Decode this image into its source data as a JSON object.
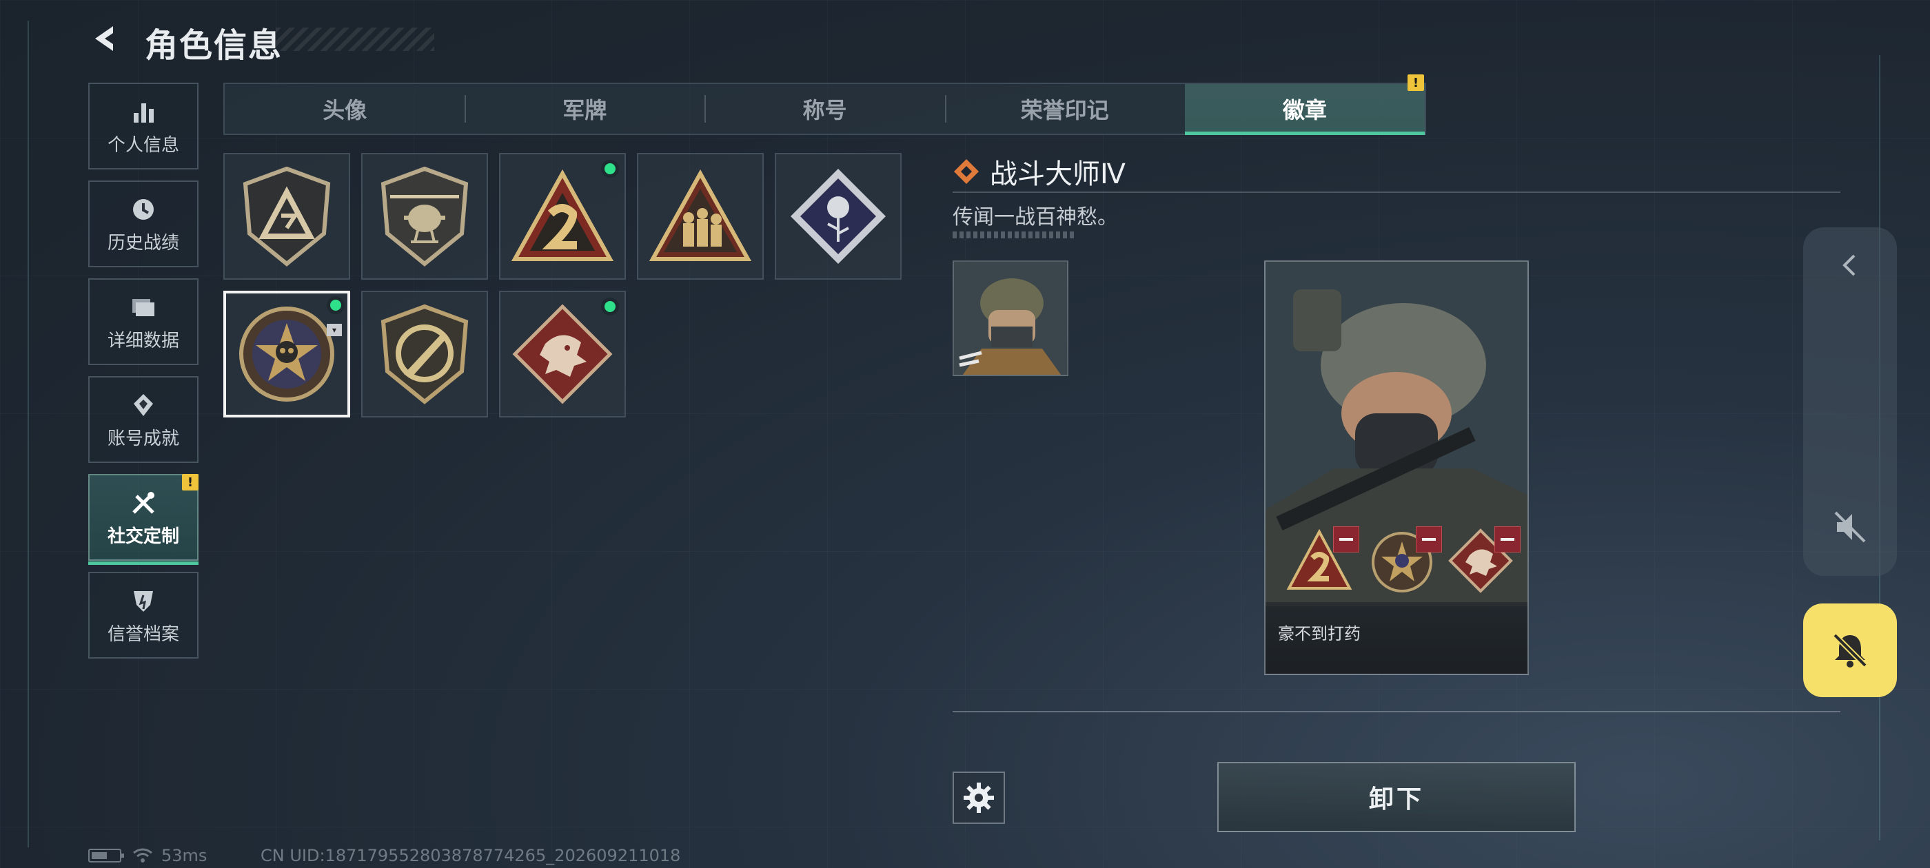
{
  "header": {
    "title": "角色信息"
  },
  "sidebar": {
    "items": [
      {
        "label": "个人信息",
        "icon": "bar-chart-icon"
      },
      {
        "label": "历史战绩",
        "icon": "clock-icon"
      },
      {
        "label": "详细数据",
        "icon": "folder-icon"
      },
      {
        "label": "账号成就",
        "icon": "achievement-icon"
      },
      {
        "label": "社交定制",
        "icon": "tools-icon",
        "active": true,
        "alert": "!"
      },
      {
        "label": "信誉档案",
        "icon": "shield-icon"
      }
    ]
  },
  "tabs": [
    {
      "label": "头像"
    },
    {
      "label": "军牌"
    },
    {
      "label": "称号"
    },
    {
      "label": "荣誉印记"
    },
    {
      "label": "徽章",
      "active": true,
      "alert": "!"
    }
  ],
  "badges": [
    {
      "name": "delta-shield-badge",
      "equipped": false
    },
    {
      "name": "helicopter-shield-badge",
      "equipped": false
    },
    {
      "name": "number-two-triangle-badge",
      "equipped": true
    },
    {
      "name": "soldiers-triangle-badge",
      "equipped": false
    },
    {
      "name": "rose-diamond-badge",
      "equipped": false
    },
    {
      "name": "skull-star-badge",
      "equipped": true,
      "selected": true
    },
    {
      "name": "knife-shield-badge",
      "equipped": false
    },
    {
      "name": "dragon-diamond-badge",
      "equipped": true
    }
  ],
  "detail": {
    "name": "战斗大师Ⅳ",
    "description": "传闻一战百神愁。"
  },
  "preview": {
    "player_name": "豪不到打药",
    "equipped_slots": [
      "number-two-triangle-badge",
      "skull-star-badge",
      "dragon-diamond-badge"
    ]
  },
  "actions": {
    "unequip_label": "卸下"
  },
  "status": {
    "ping": "53ms",
    "uid": "CN UID:18717955280387877​4265_202609211018"
  },
  "colors": {
    "accent": "#4fc8a0",
    "alert": "#f0c43a",
    "equipped": "#2fe08a",
    "bell": "#f7e06a"
  }
}
